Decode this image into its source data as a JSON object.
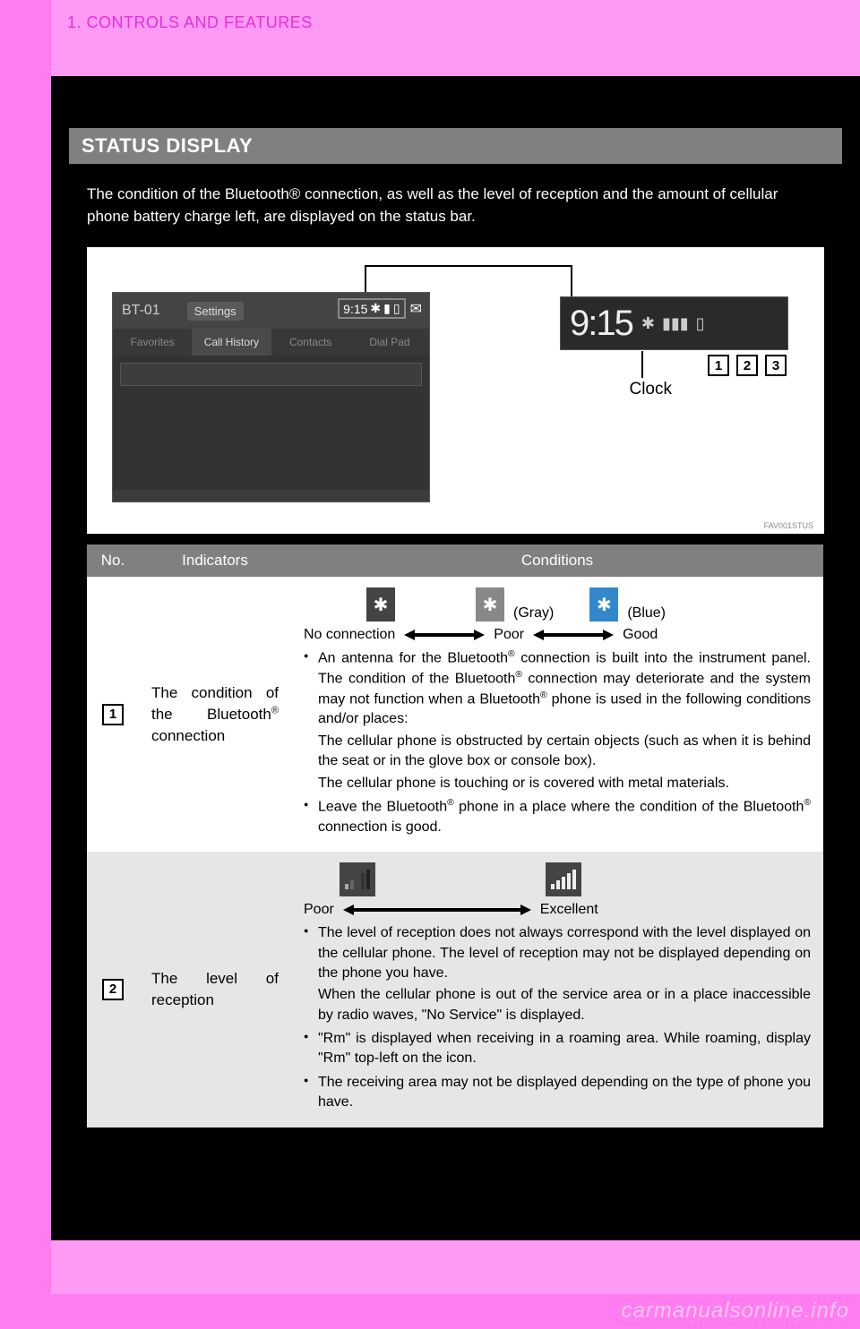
{
  "header": {
    "section": "1. CONTROLS AND FEATURES"
  },
  "title_bar": "STATUS DISPLAY",
  "intro": "The condition of the Bluetooth® connection, as well as the level of reception and the amount of cellular phone battery charge left, are displayed on the status bar.",
  "figure": {
    "phone_title": "BT-01",
    "settings": "Settings",
    "time": "9:15",
    "tabs": [
      "Favorites",
      "Call History",
      "Contacts",
      "Dial Pad"
    ],
    "active_tab": 1,
    "clock_label": "Clock",
    "zoom_time": "9:15",
    "num_labels": [
      "1",
      "2",
      "3"
    ],
    "tag": "FAV001STUS"
  },
  "table": {
    "head": {
      "no": "No.",
      "ind": "Indicators",
      "cond": "Conditions"
    },
    "row1": {
      "no": "1",
      "indicator": "The condition of the Bluetooth® connection",
      "legend": {
        "gray": "(Gray)",
        "blue": "(Blue)",
        "noconn": "No connection",
        "poor": "Poor",
        "good": "Good"
      },
      "b1_lead": "An antenna for the Bluetooth® connection is built into the instrument panel. The condition of the Bluetooth® connection may deteriorate and the system may not function when a Bluetooth® phone is used in the following conditions and/or places:",
      "b1_sub1": "The cellular phone is obstructed by certain objects (such as when it is behind the seat or in the glove box or console box).",
      "b1_sub2": "The cellular phone is touching or is covered with metal materials.",
      "b2": "Leave the Bluetooth® phone in a place where the condition of the Bluetooth® connection is good."
    },
    "row2": {
      "no": "2",
      "indicator": "The level of reception",
      "legend": {
        "poor": "Poor",
        "excellent": "Excellent"
      },
      "b1_lead": "The level of reception does not always correspond with the level displayed on the cellular phone. The level of reception may not be displayed depending on the phone you have.",
      "b1_sub1": "When the cellular phone is out of the service area or in a place inaccessible by radio waves, \"No Service\" is displayed.",
      "b2": "\"Rm\" is displayed when receiving in a roaming area. While roaming, display \"Rm\" top-left on the icon.",
      "b3": "The receiving area may not be displayed depending on the type of phone you have."
    }
  },
  "chart_data": [
    {
      "type": "table",
      "title": "Bluetooth connection condition scale",
      "categories": [
        "No connection",
        "Poor",
        "Good"
      ],
      "icon_color": [
        "dark",
        "gray",
        "blue"
      ]
    },
    {
      "type": "table",
      "title": "Reception level scale",
      "categories": [
        "Poor",
        "Excellent"
      ]
    }
  ],
  "watermark": "carmanualsonline.info"
}
